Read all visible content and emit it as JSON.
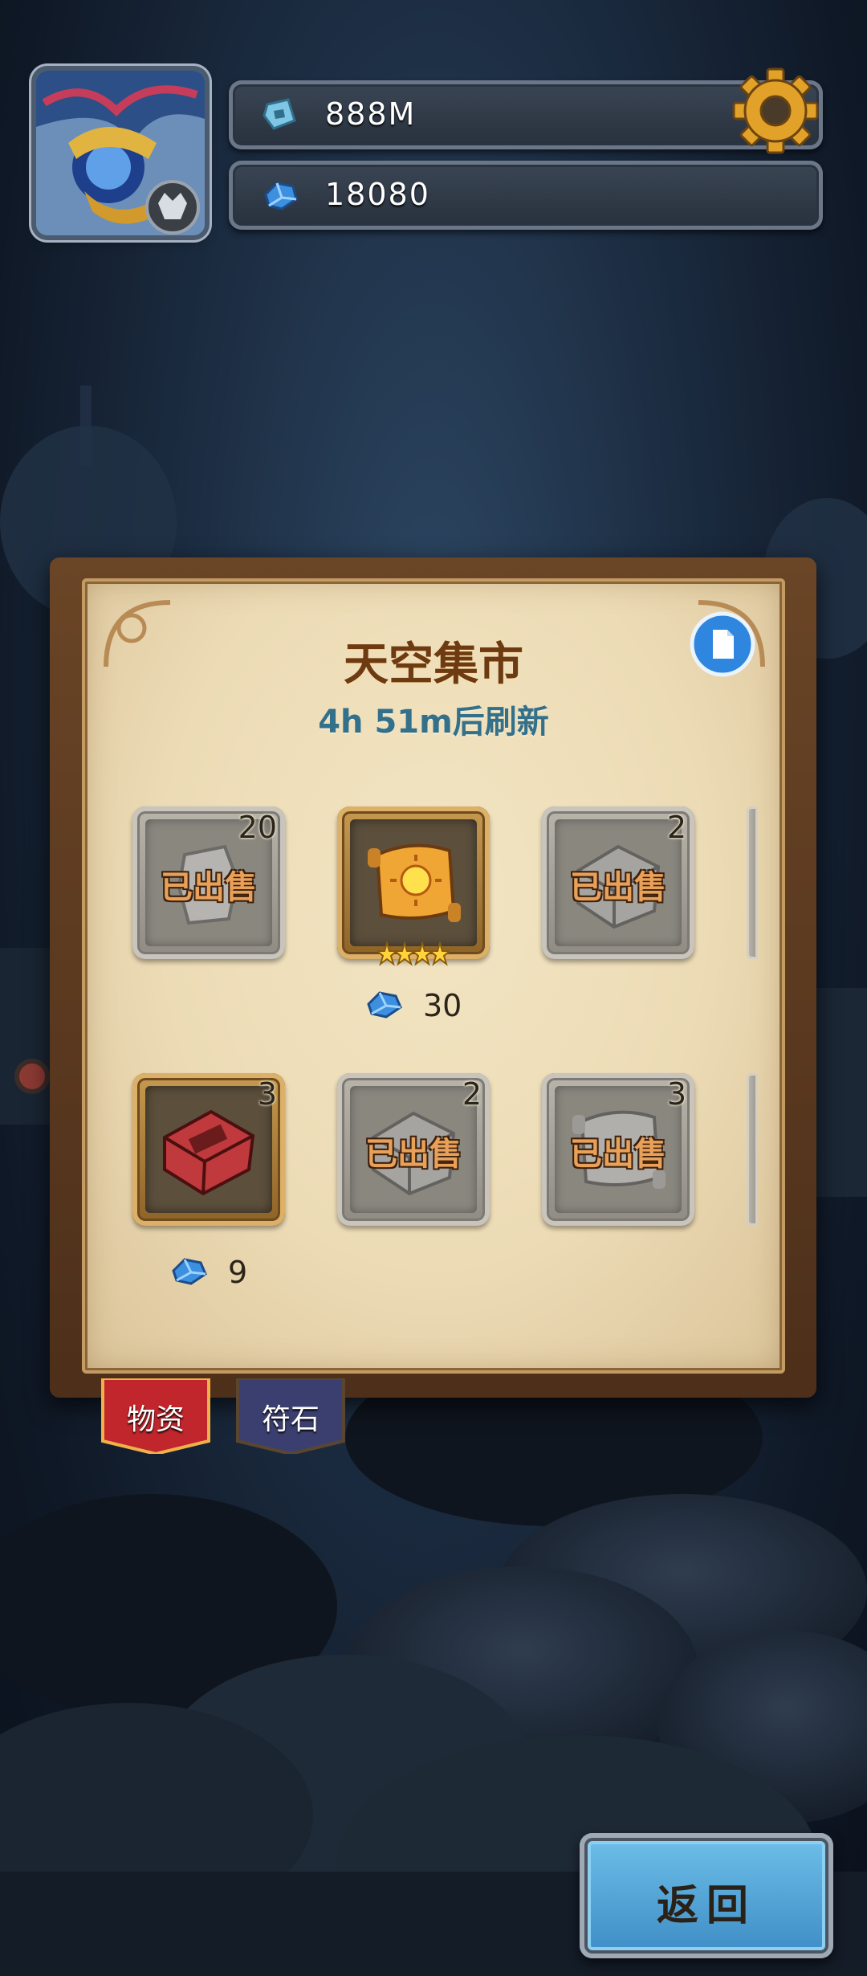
{
  "header": {
    "resources": [
      {
        "icon": "rune-coin-icon",
        "value": "888M"
      },
      {
        "icon": "blue-gem-icon",
        "value": "18080"
      }
    ]
  },
  "market": {
    "title": "天空集市",
    "refresh_text": "4h 51m后刷新",
    "items": [
      {
        "icon": "stone-icon",
        "quantity": "20",
        "status": "已出售",
        "sold": true
      },
      {
        "icon": "sun-scroll-icon",
        "quantity": "",
        "status": "",
        "sold": false,
        "stars": 4,
        "price": "30"
      },
      {
        "icon": "metal-box-icon",
        "quantity": "2",
        "status": "已出售",
        "sold": true
      },
      {
        "icon": "red-box-icon",
        "quantity": "3",
        "status": "",
        "sold": false,
        "price": "9"
      },
      {
        "icon": "metal-box-icon",
        "quantity": "2",
        "status": "已出售",
        "sold": true
      },
      {
        "icon": "scroll-icon",
        "quantity": "3",
        "status": "已出售",
        "sold": true
      }
    ]
  },
  "tabs": [
    {
      "label": "物资",
      "active": true
    },
    {
      "label": "符石",
      "active": false
    }
  ],
  "footer": {
    "back_label": "返回"
  }
}
